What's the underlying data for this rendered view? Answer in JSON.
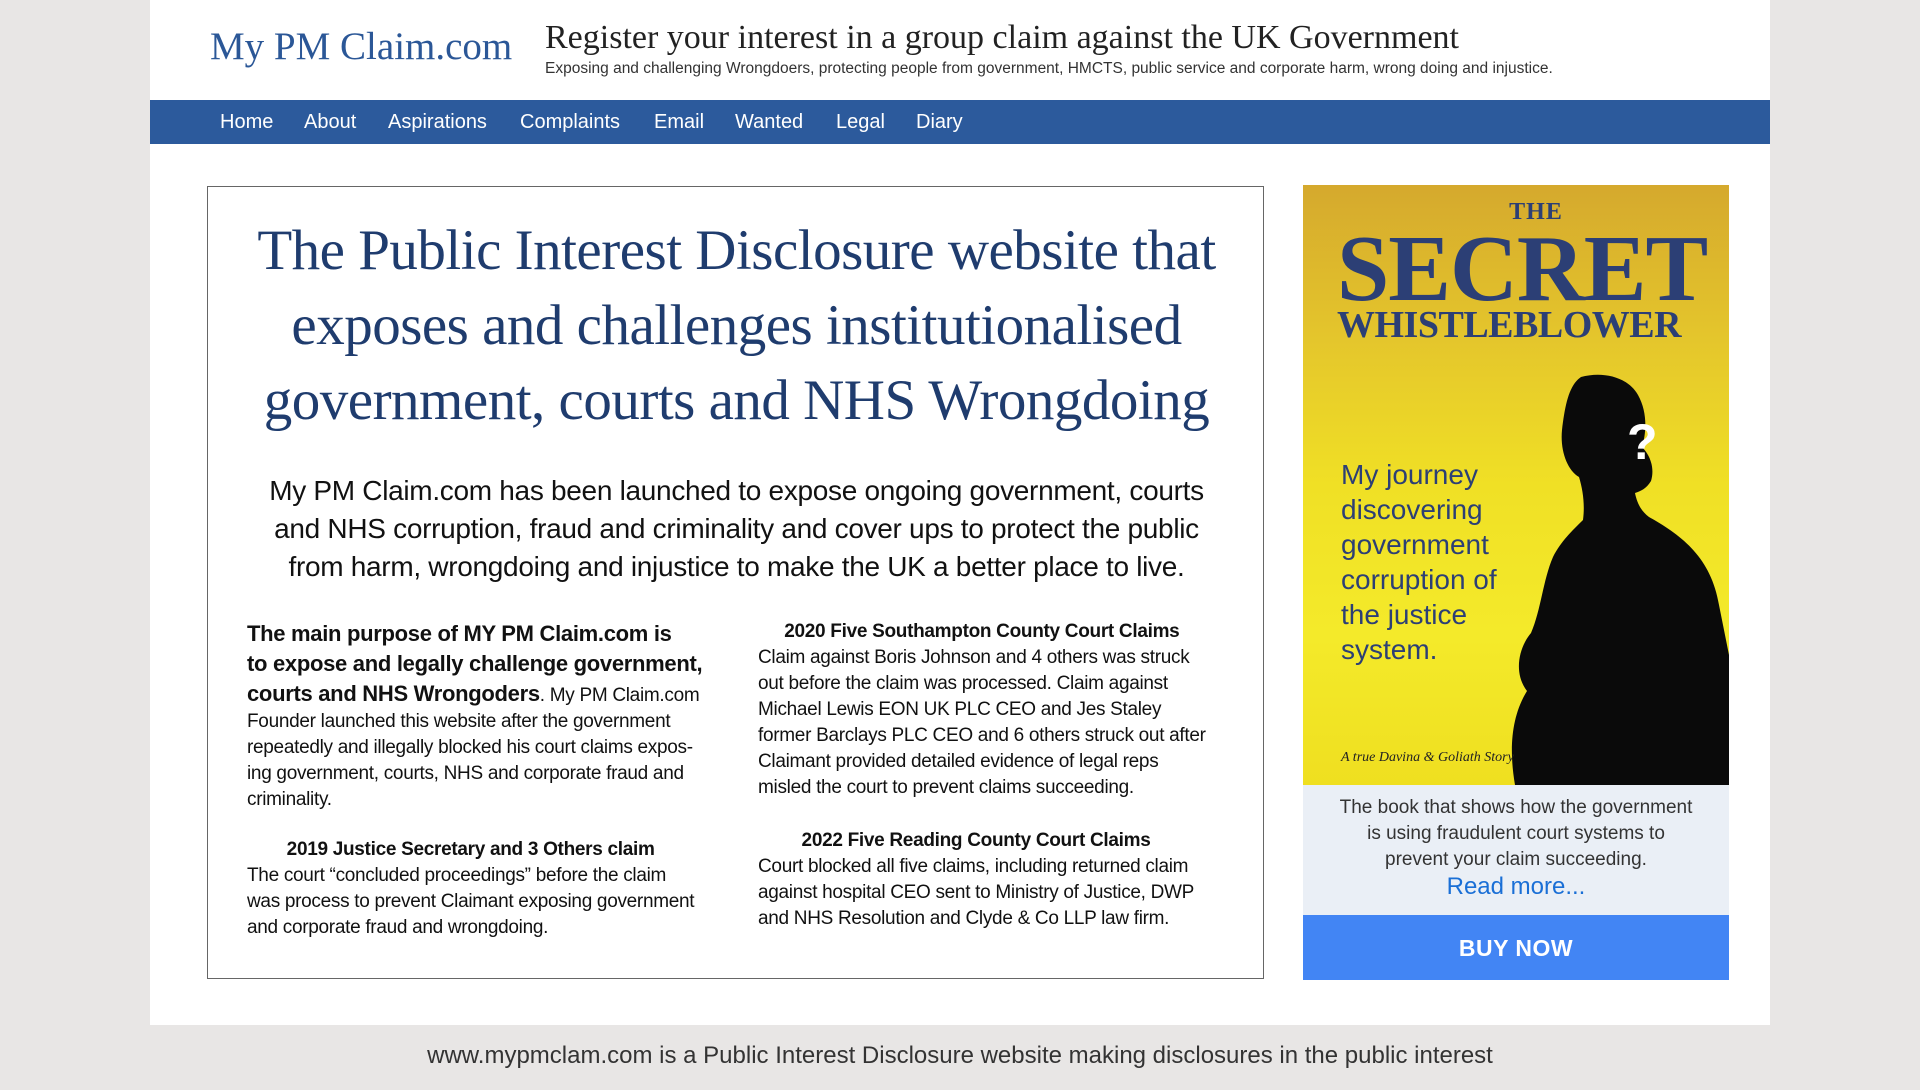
{
  "header": {
    "logo": "My PM Claim.com",
    "title": "Register your interest in a group claim against the UK Government",
    "tagline": "Exposing and challenging Wrongdoers, protecting people from government, HMCTS, public service and corporate harm, wrong doing and injustice."
  },
  "nav": {
    "items": [
      {
        "label": "Home"
      },
      {
        "label": "About"
      },
      {
        "label": "Aspirations"
      },
      {
        "label": "Complaints"
      },
      {
        "label": "Email"
      },
      {
        "label": "Wanted"
      },
      {
        "label": "Legal"
      },
      {
        "label": "Diary"
      }
    ]
  },
  "main": {
    "headline_lines": [
      "The Public Interest Disclosure website that",
      "exposes and challenges institutionalised",
      "government, courts and NHS Wrongdoing"
    ],
    "intro_lines": [
      "My PM Claim.com has been launched to expose ongoing government, courts",
      "and NHS corruption, fraud and criminality and cover ups to protect the public",
      "from harm, wrongdoing and  injustice to make the UK a better place to live."
    ],
    "purpose": {
      "lead_lines": [
        "The main purpose of MY PM Claim.com is",
        "to expose and legally challenge government,",
        "courts and NHS Wrongoders"
      ],
      "lead_tail": ". My PM Claim.com",
      "body_lines": [
        "Founder launched this website after the government",
        "repeatedly and illegally blocked his court claims expos-",
        "ing government, courts, NHS and corporate fraud and",
        "criminality."
      ]
    },
    "claim_2019": {
      "heading": "2019 Justice Secretary and 3 Others claim",
      "lines": [
        "The court “concluded proceedings” before the claim",
        "was process to prevent Claimant exposing government",
        "and corporate fraud and wrongdoing."
      ]
    },
    "claim_2020": {
      "heading": "2020 Five Southampton County Court Claims",
      "lines": [
        "Claim against Boris Johnson and 4 others was struck",
        "out before the claim was processed. Claim against",
        "Michael Lewis EON UK PLC CEO and Jes Staley",
        "former Barclays PLC CEO and 6 others struck out after",
        "Claimant provided detailed evidence of legal reps",
        "misled the court to prevent claims succeeding."
      ]
    },
    "claim_2022": {
      "heading": "2022 Five Reading County Court Claims",
      "lines": [
        "Court blocked all five claims, including returned claim",
        "against hospital CEO sent to Ministry of Justice, DWP",
        "and NHS Resolution and Clyde & Co LLP  law firm."
      ]
    }
  },
  "book": {
    "cover_the": "THE",
    "cover_secret": "SECRET",
    "cover_whistleblower": "WHISTLEBLOWER",
    "cover_journey_lines": [
      "My journey",
      "discovering",
      "government",
      "corruption of",
      "the justice",
      "system."
    ],
    "cover_question": "?",
    "cover_story": "A true Davina & Goliath Story",
    "caption_lines": [
      "The book that shows how the government",
      "is using fraudulent court systems to",
      "prevent your claim succeeding."
    ],
    "read_more": "Read more...",
    "buy_now": "BUY NOW"
  },
  "footer": {
    "text": "www.mypmclam.com is a Public Interest Disclosure website making disclosures in the public interest"
  },
  "colors": {
    "nav_bg": "#2c5a9c",
    "logo": "#2b5797",
    "headline": "#1f3c6e",
    "buy_button": "#4285f4",
    "read_more_link": "#1a6fd6",
    "cover_text": "#2c3f75",
    "cover_yellow": "#f0e025"
  }
}
